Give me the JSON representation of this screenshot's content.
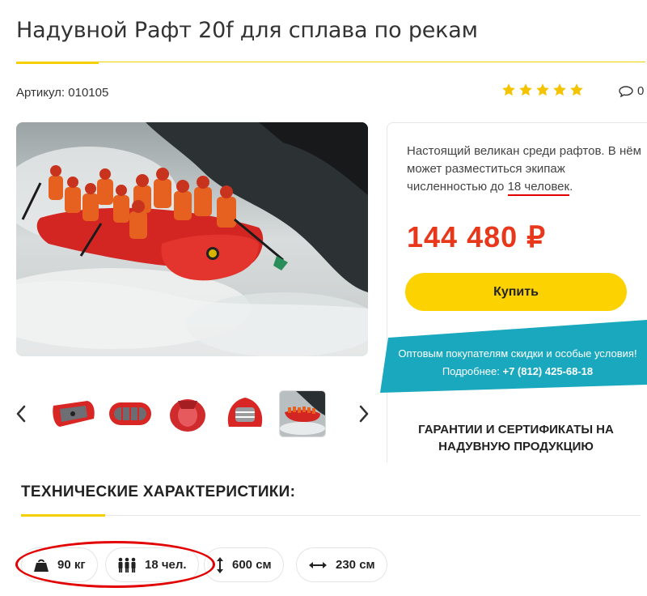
{
  "product": {
    "title": "Надувной Рафт 20f для сплава по рекам",
    "sku": "Артикул: 010105",
    "rating_stars": 5,
    "comments_count": "0"
  },
  "colors": {
    "accent_yellow": "#f5cf00",
    "price_red": "#e8371a",
    "promo_teal": "#1aa8bf",
    "annotation_red": "#e30000"
  },
  "gallery": {
    "prev_icon": "chevron-left-icon",
    "next_icon": "chevron-right-icon",
    "thumbnails_count": 5,
    "active_thumbnail": 5
  },
  "card": {
    "text_before": "Настоящий великан среди рафтов. В нём может разместиться экипаж численностью до ",
    "text_highlight": "18 человек",
    "text_after": ".",
    "price": "144 480 ₽",
    "buy_label": "Купить",
    "promo_line1": "Оптовым покупателям скидки и особые условия!",
    "promo_line2_label": "Подробнее:",
    "promo_phone": "+7 (812) 425-68-18",
    "guarantees": "ГАРАНТИИ И СЕРТИФИКАТЫ НА НАДУВНУЮ ПРОДУКЦИЮ"
  },
  "specs": {
    "title": "ТЕХНИЧЕСКИЕ ХАРАКТЕРИСТИКИ:",
    "items": [
      {
        "icon": "weight-icon",
        "value": "90 кг"
      },
      {
        "icon": "people-icon",
        "value": "18 чел."
      },
      {
        "icon": "vertical-arrow-icon",
        "value": "600 см"
      },
      {
        "icon": "horizontal-arrow-icon",
        "value": "230 см"
      }
    ]
  }
}
